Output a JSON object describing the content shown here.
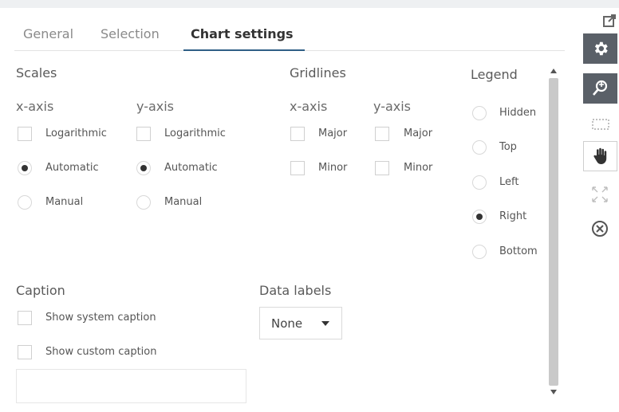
{
  "tabs": [
    {
      "label": "General"
    },
    {
      "label": "Selection"
    },
    {
      "label": "Chart settings",
      "active": true
    }
  ],
  "scales": {
    "heading": "Scales",
    "x_axis": {
      "label": "x-axis",
      "logarithmic": {
        "label": "Logarithmic",
        "checked": false
      },
      "mode_options": [
        {
          "label": "Automatic",
          "selected": true
        },
        {
          "label": "Manual",
          "selected": false
        }
      ]
    },
    "y_axis": {
      "label": "y-axis",
      "logarithmic": {
        "label": "Logarithmic",
        "checked": false
      },
      "mode_options": [
        {
          "label": "Automatic",
          "selected": true
        },
        {
          "label": "Manual",
          "selected": false
        }
      ]
    }
  },
  "gridlines": {
    "heading": "Gridlines",
    "x_axis": {
      "label": "x-axis",
      "major": {
        "label": "Major",
        "checked": false
      },
      "minor": {
        "label": "Minor",
        "checked": false
      }
    },
    "y_axis": {
      "label": "y-axis",
      "major": {
        "label": "Major",
        "checked": false
      },
      "minor": {
        "label": "Minor",
        "checked": false
      }
    }
  },
  "legend": {
    "heading": "Legend",
    "options": [
      {
        "label": "Hidden",
        "selected": false
      },
      {
        "label": "Top",
        "selected": false
      },
      {
        "label": "Left",
        "selected": false
      },
      {
        "label": "Right",
        "selected": true
      },
      {
        "label": "Bottom",
        "selected": false
      }
    ]
  },
  "caption": {
    "heading": "Caption",
    "show_system": {
      "label": "Show system caption",
      "checked": false
    },
    "show_custom": {
      "label": "Show custom caption",
      "checked": false
    },
    "custom_text": ""
  },
  "data_labels": {
    "heading": "Data labels",
    "selected": "None"
  },
  "toolbar": {
    "buttons": [
      "popout-icon",
      "settings-gear-icon",
      "zoom-search-icon",
      "marquee-select-icon",
      "pan-hand-icon",
      "expand-arrows-icon",
      "close-circle-icon"
    ]
  },
  "colors": {
    "toolbar_active_bg": "#5a6068",
    "tab_underline": "#2f5f86",
    "scrollbar": "#c9c9c9"
  }
}
